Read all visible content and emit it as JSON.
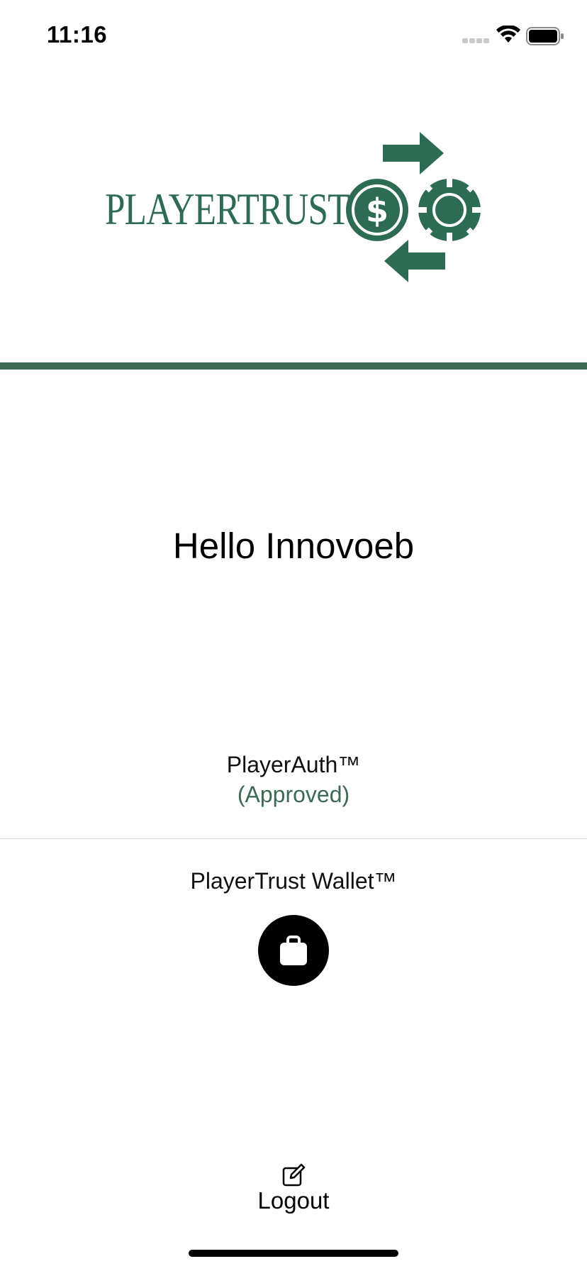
{
  "status_bar": {
    "time": "11:16",
    "icons": [
      "cellular-signal-icon",
      "wifi-icon",
      "battery-icon"
    ]
  },
  "logo": {
    "text": "PLAYERTRUST",
    "icon": "dollar-chip-exchange-icon"
  },
  "greeting": "Hello Innovoeb",
  "player_auth": {
    "label": "PlayerAuth™",
    "status": "(Approved)"
  },
  "wallet": {
    "label": "PlayerTrust Wallet™",
    "icon": "shopping-bag-icon"
  },
  "logout": {
    "label": "Logout",
    "icon": "edit-icon"
  },
  "colors": {
    "brand_green": "#3c6a55",
    "logo_green": "#2e6b53",
    "divider": "#d6d6d6"
  }
}
